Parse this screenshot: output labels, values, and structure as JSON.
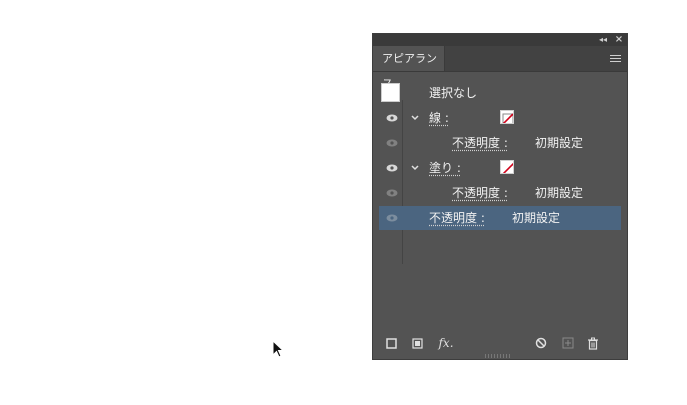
{
  "panel": {
    "tab_label": "アピアランス",
    "selection_label": "選択なし",
    "rows": [
      {
        "label": "線 :",
        "type": "stroke"
      },
      {
        "label": "不透明度 :",
        "value": "初期設定"
      },
      {
        "label": "塗り :",
        "type": "fill"
      },
      {
        "label": "不透明度 :",
        "value": "初期設定"
      },
      {
        "label": "不透明度 :",
        "value": "初期設定"
      }
    ],
    "footer_icons": [
      "new-stroke-icon",
      "new-fill-icon",
      "fx-icon",
      "clear-appearance-icon",
      "duplicate-item-icon",
      "delete-item-icon"
    ],
    "fx_label": "fx."
  },
  "colors": {
    "panel_bg": "#535353",
    "selected_row": "#4b6580",
    "swatch_slash": "#d0021b"
  }
}
